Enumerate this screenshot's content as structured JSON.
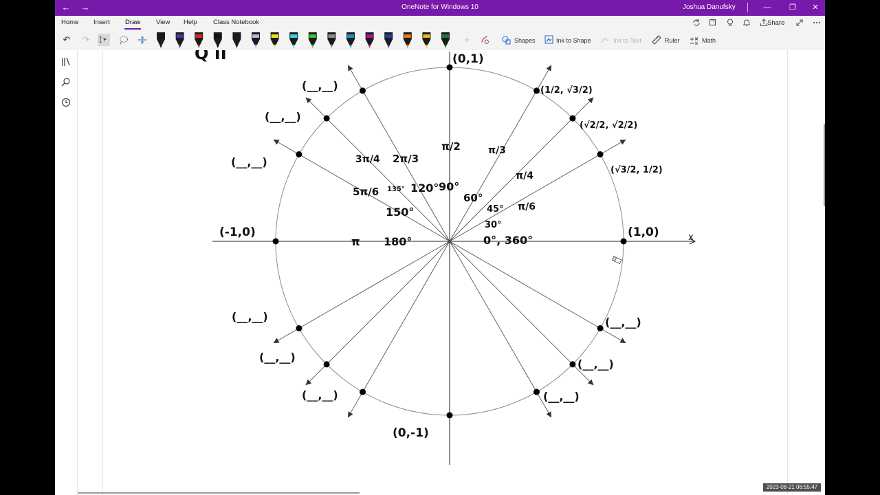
{
  "window": {
    "title": "OneNote for Windows 10",
    "user": "Joshua Danufsky",
    "back_icon": "←",
    "forward_icon": "→",
    "minimize_icon": "—",
    "restore_icon": "❐",
    "close_icon": "✕"
  },
  "menu": {
    "tabs": [
      "Home",
      "Insert",
      "Draw",
      "View",
      "Help",
      "Class Notebook"
    ],
    "active_tab": "Draw",
    "share_label": "Share"
  },
  "toolbar": {
    "undo_icon": "↶",
    "redo_icon": "↷",
    "pen_colors": [
      "#1a1a1a",
      "#3b3b9a",
      "#d12a2a",
      "#111111",
      "#1a1a1a",
      "#c9a7e8",
      "#f2e11a",
      "#31d6e8",
      "#32c832",
      "#8a8a8a",
      "#1e90c8",
      "#b0148a",
      "#1b3f9c",
      "#e8791a",
      "#e8b81a",
      "#1a7a3a"
    ],
    "shapes_label": "Shapes",
    "ink_to_shape_label": "Ink to Shape",
    "ink_to_text_label": "Ink to Text",
    "ruler_label": "Ruler",
    "math_label": "Math"
  },
  "sidenav": {
    "notebooks_icon": "notebooks-icon",
    "search_icon": "search-icon",
    "recent_icon": "recent-icon"
  },
  "drawing": {
    "axis_label_x": "x",
    "partial_heading": "Q II",
    "points": {
      "top": "(0,1)",
      "bottom": "(0,-1)",
      "left": "(-1,0)",
      "right": "(1,0)",
      "p30": "(√3/2, 1/2)",
      "p45": "(√2/2, √2/2)",
      "p60": "(1/2, √3/2)",
      "blank": "(__,__)"
    },
    "angle_labels": {
      "deg_0": "0°, 360°",
      "deg_30": "30°",
      "deg_45": "45°",
      "deg_60": "60°",
      "deg_90": "90°",
      "deg_120": "120°",
      "deg_135": "135°",
      "deg_150": "150°",
      "deg_180": "180°",
      "rad_30": "π/6",
      "rad_45": "π/4",
      "rad_60": "π/3",
      "rad_90": "π/2",
      "rad_120": "2π/3",
      "rad_135": "3π/4",
      "rad_150": "5π/6",
      "rad_180": "π"
    }
  },
  "timestamp": "2023-08-21 06:55:47"
}
